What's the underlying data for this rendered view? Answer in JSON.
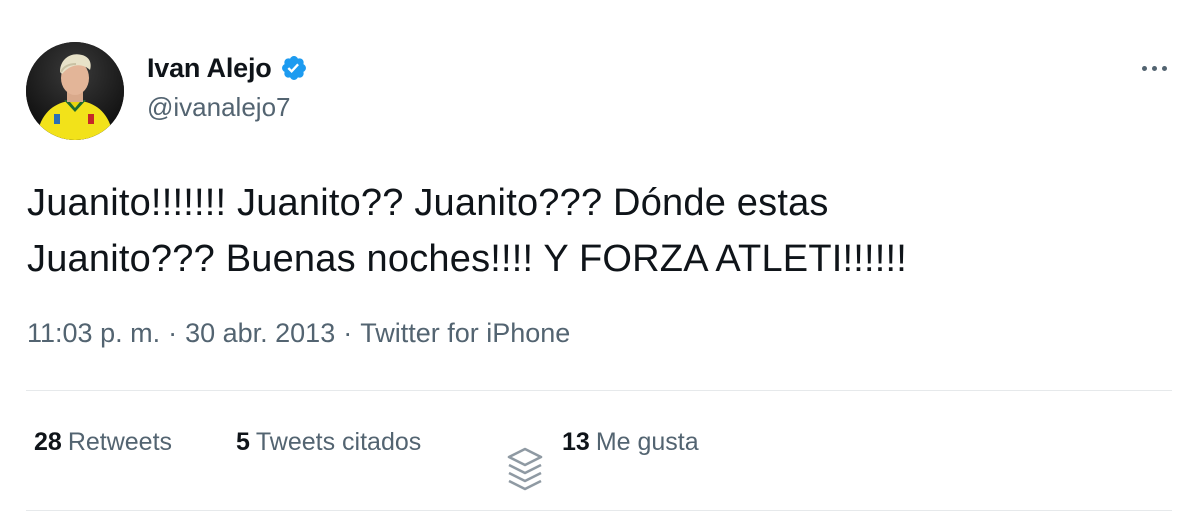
{
  "tweet": {
    "author": {
      "display_name": "Ivan Alejo",
      "handle": "@ivanalejo7",
      "verified": true
    },
    "text": "Juanito!!!!!!! Juanito?? Juanito??? Dónde estas\nJuanito??? Buenas noches!!!! Y FORZA ATLETI!!!!!!",
    "time": "11:03 p. m.",
    "date": "30 abr. 2013",
    "separator": "·",
    "source": "Twitter for iPhone",
    "stats": {
      "retweets_count": "28",
      "retweets_label": "Retweets",
      "quotes_count": "5",
      "quotes_label": "Tweets citados",
      "likes_count": "13",
      "likes_label": "Me gusta"
    }
  },
  "icons": {
    "verified": "verified-badge-icon",
    "more": "more-options-icon",
    "overlay": "stack-layers-icon"
  },
  "colors": {
    "text_primary": "#0f1419",
    "text_secondary": "#536471",
    "verified_blue": "#1d9bf0",
    "divider": "#e6e9eb"
  }
}
